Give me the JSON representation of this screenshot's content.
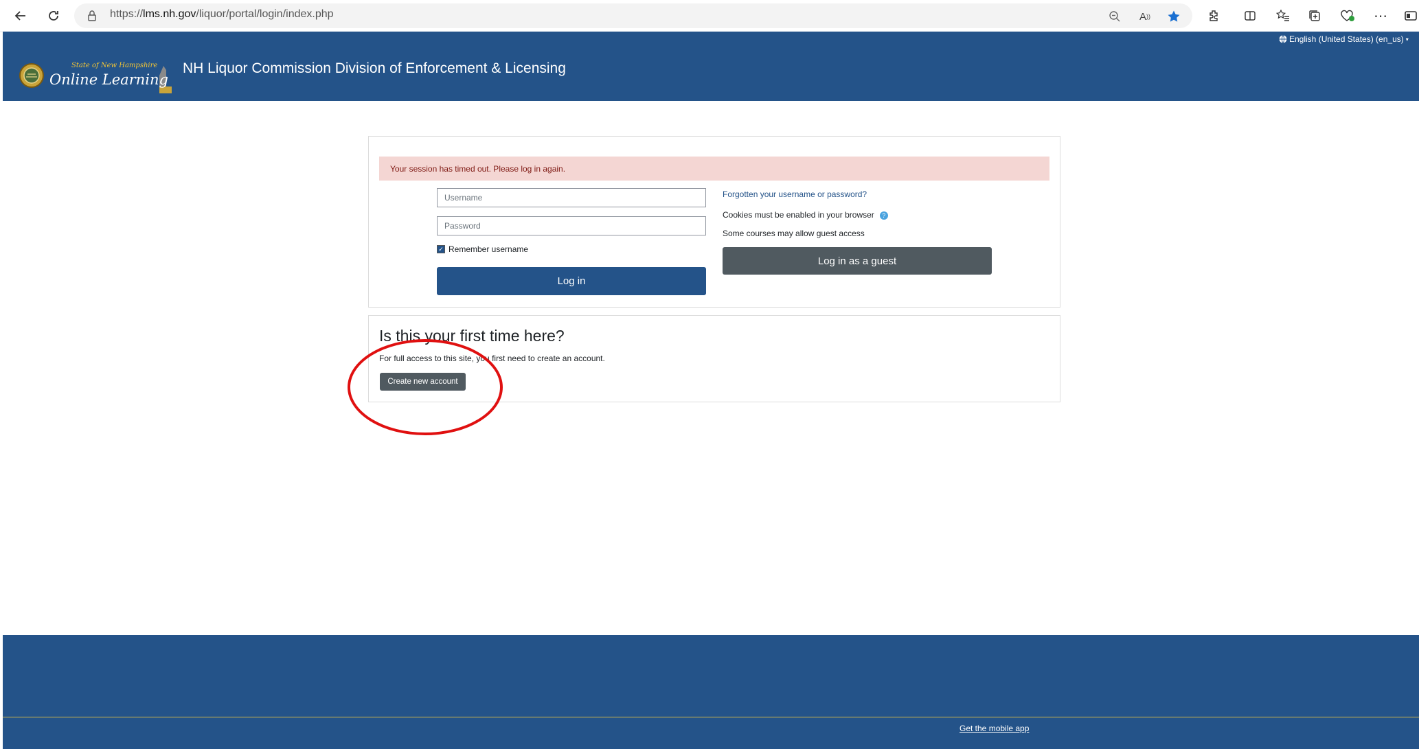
{
  "browser": {
    "url_prefix": "https://",
    "url_host": "lms.nh.gov",
    "url_path": "/liquor/portal/login/index.php",
    "icons": [
      "back-icon",
      "refresh-icon",
      "lock-icon",
      "zoom-out-icon",
      "read-aloud-icon",
      "favorite-star-icon",
      "extensions-icon",
      "split-screen-icon",
      "favorites-list-icon",
      "collections-icon",
      "browser-essentials-icon",
      "more-icon",
      "sidebar-icon"
    ]
  },
  "header": {
    "site_title": "NH Liquor Commission Division of Enforcement & Licensing",
    "logo_line1": "State of New Hampshire",
    "logo_line2": "Online Learning",
    "language": "English (United States) (en_us)",
    "accent_color": "#245389"
  },
  "login": {
    "alert": "Your session has timed out. Please log in again.",
    "username_placeholder": "Username",
    "password_placeholder": "Password",
    "remember_label": "Remember username",
    "remember_checked": true,
    "login_button": "Log in",
    "forgot_link": "Forgotten your username or password?",
    "cookies_text": "Cookies must be enabled in your browser",
    "guest_text": "Some courses may allow guest access",
    "guest_button": "Log in as a guest"
  },
  "signup": {
    "heading": "Is this your first time here?",
    "text": "For full access to this site, you first need to create an account.",
    "create_button": "Create new account"
  },
  "footer": {
    "mobile_app_link": "Get the mobile app"
  }
}
